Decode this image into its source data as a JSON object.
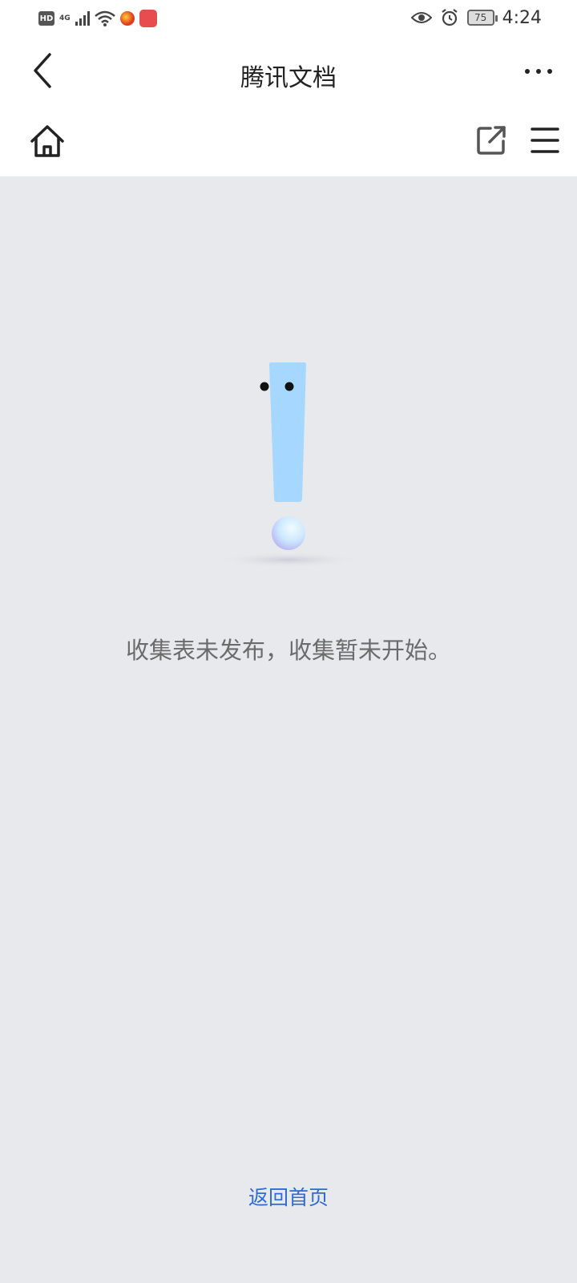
{
  "status_bar": {
    "hd_label": "HD",
    "network_label": "4G",
    "battery_level": "75",
    "time": "4:24",
    "icons": [
      "hd-icon",
      "signal-icon",
      "wifi-icon",
      "app-icon",
      "app-icon",
      "eye-icon",
      "alarm-icon",
      "battery-icon"
    ]
  },
  "nav": {
    "title": "腾讯文档",
    "back_icon": "chevron-left-icon",
    "more_icon": "more-dots-icon"
  },
  "toolbar": {
    "home_icon": "home-icon",
    "share_icon": "external-link-icon",
    "menu_icon": "hamburger-menu-icon"
  },
  "main": {
    "message": "收集表未发布，收集暂未开始。",
    "return_label": "返回首页"
  },
  "colors": {
    "content_bg": "#e8e9ec",
    "link": "#2d6bd6",
    "message": "#6b6b6b",
    "exclaim": "#a6d7ff"
  }
}
